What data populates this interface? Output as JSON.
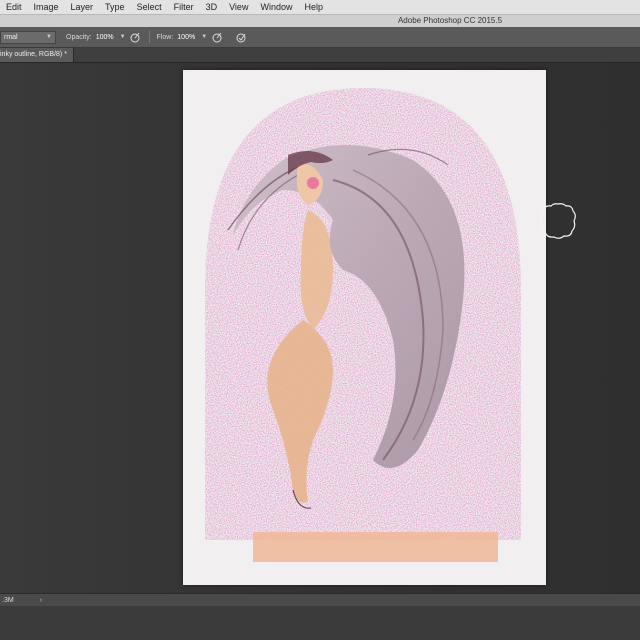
{
  "menubar": {
    "items": [
      "Edit",
      "Image",
      "Layer",
      "Type",
      "Select",
      "Filter",
      "3D",
      "View",
      "Window",
      "Help"
    ]
  },
  "titlebar": {
    "title": "Adobe Photoshop CC 2015.5"
  },
  "options": {
    "mode_value": "rmal",
    "opacity_label": "Opacity:",
    "opacity_value": "100%",
    "flow_label": "Flow:",
    "flow_value": "100%"
  },
  "document": {
    "tab_label": "inky outline, RGB/8) *"
  },
  "statusbar": {
    "zoom": ".3M",
    "arrow": "›"
  },
  "icons": {
    "airbrush": "airbrush-icon",
    "pressure": "pressure-icon",
    "brush_cursor": "brush-cursor-icon"
  },
  "colors": {
    "pink": "#d97bbd",
    "canvas": "#f1efef",
    "hair": "#b8a6b2",
    "skin": "#e8b48c"
  }
}
